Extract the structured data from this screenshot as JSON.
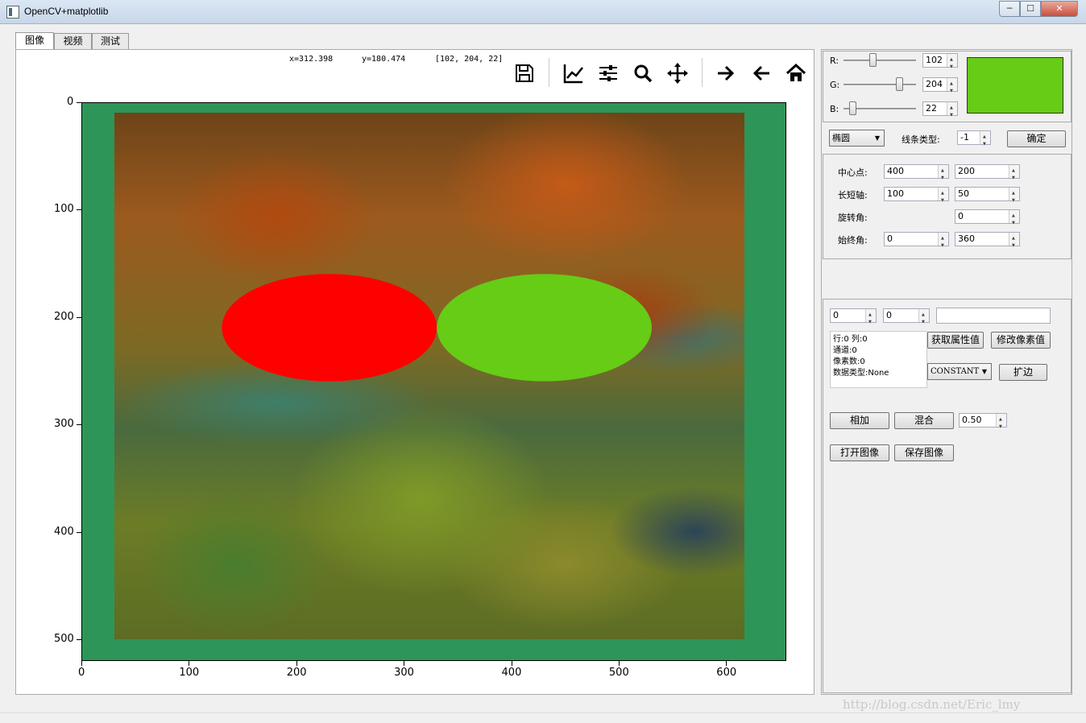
{
  "window": {
    "title": "OpenCV+matplotlib",
    "min": "─",
    "max": "☐",
    "close": "✕"
  },
  "tabs": [
    {
      "label": "图像",
      "active": true
    },
    {
      "label": "视频"
    },
    {
      "label": "测试"
    }
  ],
  "readout": {
    "x": "x=312.398",
    "y": "y=180.474",
    "rgb": "[102, 204, 22]"
  },
  "toolbar": [
    "save-icon",
    "subplots-icon",
    "configure-icon",
    "zoom-icon",
    "pan-icon",
    "forward-icon",
    "back-icon",
    "home-icon"
  ],
  "axes": {
    "x_ticks": [
      "0",
      "100",
      "200",
      "300",
      "400",
      "500",
      "600"
    ],
    "y_ticks": [
      "0",
      "100",
      "200",
      "300",
      "400",
      "500"
    ],
    "xlim": [
      0,
      656
    ],
    "ylim": [
      520,
      0
    ]
  },
  "image_content": {
    "image_extent": {
      "x": [
        30,
        616
      ],
      "y": [
        9,
        499
      ]
    },
    "ellipses": [
      {
        "center": [
          200,
          200
        ],
        "axes": [
          100,
          50
        ],
        "color": "#ff0000"
      },
      {
        "center": [
          400,
          200
        ],
        "axes": [
          100,
          50
        ],
        "color": "#66cc16"
      }
    ],
    "border_color": "#2e9558"
  },
  "color_picker": {
    "r_label": "R:",
    "r_value": "102",
    "r_fraction": 0.4,
    "g_label": "G:",
    "g_value": "204",
    "g_fraction": 0.8,
    "b_label": "B:",
    "b_value": "22",
    "b_fraction": 0.086,
    "preview_color": "#66cc16"
  },
  "shape_controls": {
    "shape": "椭圆",
    "line_type_label": "线条类型:",
    "line_type": "-1",
    "confirm": "确定"
  },
  "ellipse_params": {
    "center_label": "中心点:",
    "center_x": "400",
    "center_y": "200",
    "axes_label": "长短轴:",
    "axis_major": "100",
    "axis_minor": "50",
    "angle_label": "旋转角:",
    "angle": "0",
    "span_label": "始终角:",
    "start_angle": "0",
    "end_angle": "360"
  },
  "pixel_tools": {
    "row": "0",
    "col": "0",
    "value": "",
    "info": [
      "行:0    列:0",
      "通道:0",
      "像素数:0",
      "数据类型:None"
    ],
    "get_attr": "获取属性值",
    "set_pixel": "修改像素值",
    "border_type": "CONSTANT",
    "pad": "扩边",
    "add": "相加",
    "blend": "混合",
    "blend_alpha": "0.50",
    "open": "打开图像",
    "save": "保存图像"
  },
  "watermark": "http://blog.csdn.net/Eric_lmy"
}
